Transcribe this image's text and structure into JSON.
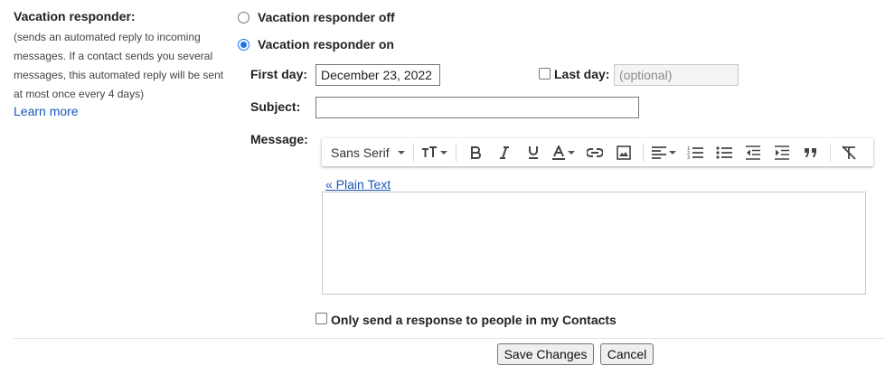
{
  "left": {
    "title": "Vacation responder:",
    "description": "(sends an automated reply to incoming messages. If a contact sends you several messages, this automated reply will be sent at most once every 4 days)",
    "learn_more": "Learn more"
  },
  "responder": {
    "off_label": "Vacation responder off",
    "on_label": "Vacation responder on",
    "selected": "on"
  },
  "first_day": {
    "label": "First day:",
    "value": "December 23, 2022"
  },
  "last_day": {
    "label": "Last day:",
    "placeholder": "(optional)",
    "checked": false
  },
  "subject": {
    "label": "Subject:",
    "value": ""
  },
  "message": {
    "label": "Message:",
    "plain_text_link": "« Plain Text",
    "value": ""
  },
  "toolbar": {
    "font_family": "Sans Serif",
    "icons": [
      "font-size-icon",
      "bold-icon",
      "italic-icon",
      "underline-icon",
      "text-color-icon",
      "link-icon",
      "image-icon",
      "align-icon",
      "numbered-list-icon",
      "bulleted-list-icon",
      "indent-less-icon",
      "indent-more-icon",
      "quote-icon",
      "remove-formatting-icon"
    ]
  },
  "contacts_only": {
    "label": "Only send a response to people in my Contacts",
    "checked": false
  },
  "buttons": {
    "save": "Save Changes",
    "cancel": "Cancel"
  },
  "colors": {
    "link": "#1a56b8",
    "radio_selected": "#1a73e8"
  }
}
